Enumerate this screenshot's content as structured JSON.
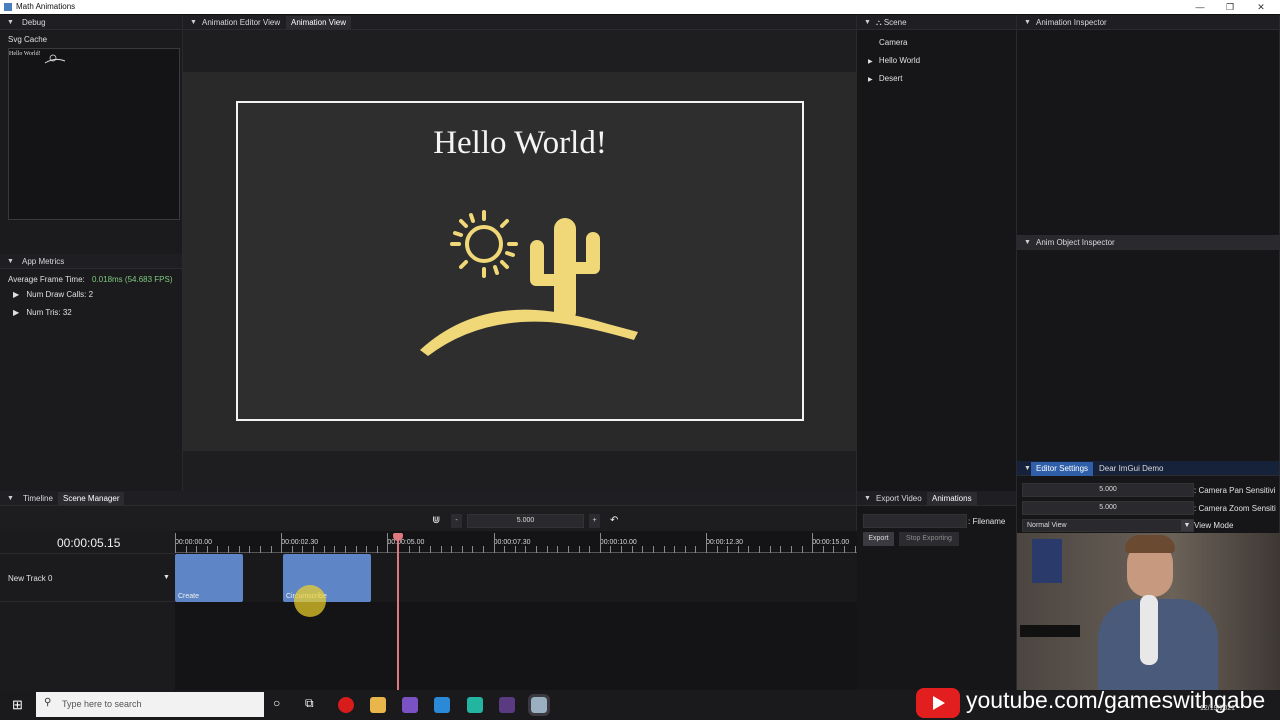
{
  "window": {
    "title": "Math Animations",
    "minimize": "—",
    "maximize": "❐",
    "close": "✕"
  },
  "debug": {
    "tab": "Debug",
    "svg_cache_label": "Svg Cache",
    "metrics_tab": "App Metrics",
    "avg_frame_label": "Average Frame Time:",
    "avg_frame_value": "0.018ms (54.683 FPS)",
    "draw_calls": "Num Draw Calls: 2",
    "num_tris": "Num Tris: 32"
  },
  "editor": {
    "tabs": [
      "Animation Editor View",
      "Animation View"
    ],
    "title_text": "Hello World!"
  },
  "scene": {
    "tab": "Scene",
    "items": [
      "Camera",
      "Hello World",
      "Desert"
    ]
  },
  "inspector": {
    "tab": "Animation Inspector"
  },
  "anim_object_inspector": {
    "tab": "Anim Object Inspector"
  },
  "editor_settings": {
    "tabs": [
      "Editor Settings",
      "Dear ImGui Demo"
    ],
    "pan_value": "5.000",
    "pan_label": ": Camera Pan Sensitivi",
    "zoom_value": "5.000",
    "zoom_label": ": Camera Zoom Sensiti",
    "view_value": "Normal View",
    "view_label": "View Mode"
  },
  "timeline": {
    "tabs": [
      "Timeline",
      "Scene Manager"
    ],
    "current_time": "00:00:05.15",
    "zoom_value": "5.000",
    "minus": "-",
    "plus": "+",
    "ticks": [
      "00:00:00.00",
      "00:00:02.30",
      "00:00:05.00",
      "00:00:07.30",
      "00:00:10.00",
      "00:00:12.30",
      "00:00:15.00"
    ],
    "track_name": "New Track 0",
    "clips": [
      "Create",
      "Circumscribe"
    ]
  },
  "export": {
    "tabs": [
      "Export Video",
      "Animations"
    ],
    "filename_label": ": Filename",
    "export_button": "Export",
    "stop_button": "Stop Exporting"
  },
  "taskbar": {
    "search_placeholder": "Type here to search",
    "watermark": "youtube.com/gameswithgabe",
    "date": "12/19/2021"
  },
  "colors": {
    "accent": "#2f5fa8",
    "clip": "#5e85c6",
    "playhead": "#e07880",
    "scene_art": "#f0d878"
  }
}
